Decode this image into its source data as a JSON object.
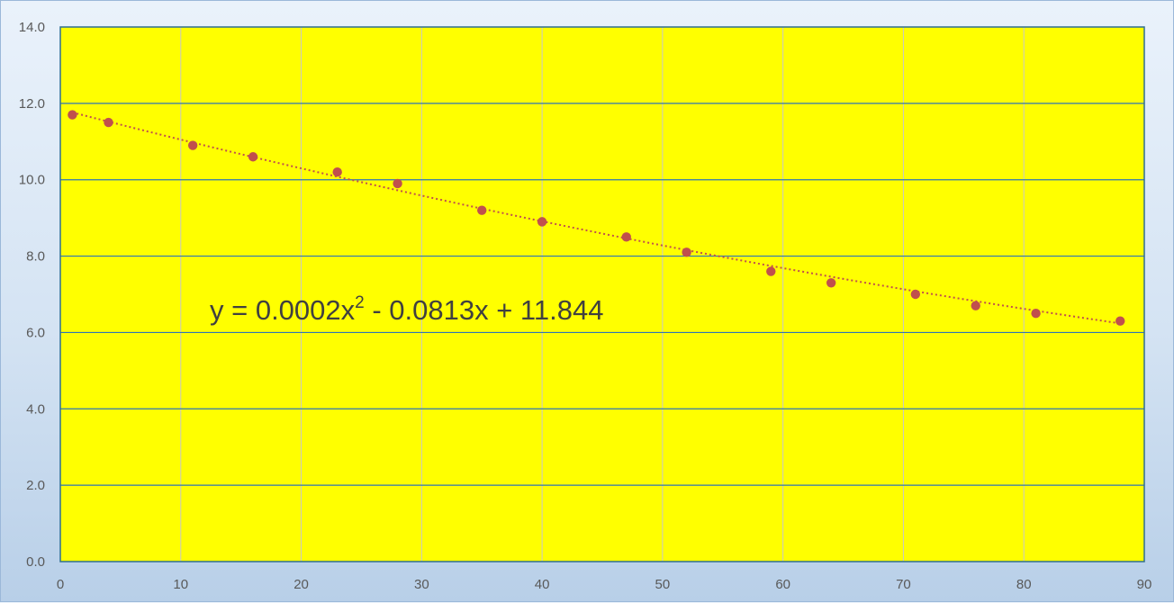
{
  "chart_data": {
    "type": "scatter",
    "title": "",
    "xlabel": "",
    "ylabel": "",
    "xlim": [
      0,
      90
    ],
    "ylim": [
      0,
      14
    ],
    "x_ticks": [
      "0",
      "10",
      "20",
      "30",
      "40",
      "50",
      "60",
      "70",
      "80",
      "90"
    ],
    "y_ticks": [
      "0.0",
      "2.0",
      "4.0",
      "6.0",
      "8.0",
      "10.0",
      "12.0",
      "14.0"
    ],
    "grid": true,
    "series": [
      {
        "x": [
          1,
          4,
          11,
          16,
          23,
          28,
          35,
          40,
          47,
          52,
          59,
          64,
          71,
          76,
          81,
          88
        ],
        "y": [
          11.7,
          11.5,
          10.9,
          10.6,
          10.2,
          9.9,
          9.2,
          8.9,
          8.5,
          8.1,
          7.6,
          7.3,
          7.0,
          6.7,
          6.5,
          6.3
        ]
      }
    ],
    "trendline": {
      "type": "polynomial",
      "order": 2,
      "coefficients": [
        0.0002,
        -0.0813,
        11.844
      ],
      "x_range": [
        1,
        88
      ],
      "equation_parts": [
        "y = 0.0002x",
        "2",
        " - 0.0813x + 11.844"
      ]
    },
    "colors": {
      "plot_background": "#ffff00",
      "marker": "#c0504d",
      "trendline": "#c0504d",
      "gridline": "#c8c8c8",
      "horizontal_gridline": "#2e75b6"
    }
  }
}
